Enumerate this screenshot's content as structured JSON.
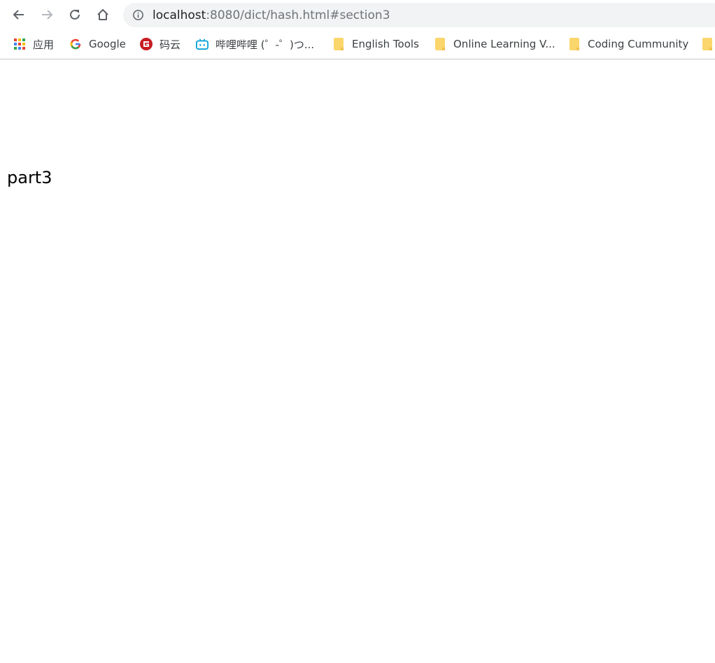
{
  "browser": {
    "url_host": "localhost",
    "url_rest": ":8080/dict/hash.html#section3",
    "colors": {
      "omnibox_bg": "#f1f3f4",
      "folder": "#fbd66c",
      "code_cloud_red": "#c71d23",
      "bilibili_blue": "#00a1d6"
    }
  },
  "bookmarks": {
    "apps": "应用",
    "google": "Google",
    "gitee": "码云",
    "bilibili": "哔哩哔哩 (゜-゜)つ...",
    "english_tools": "English Tools",
    "online_learning": "Online Learning V...",
    "coding_community": "Coding Cummunity"
  },
  "page": {
    "text": "part3"
  }
}
